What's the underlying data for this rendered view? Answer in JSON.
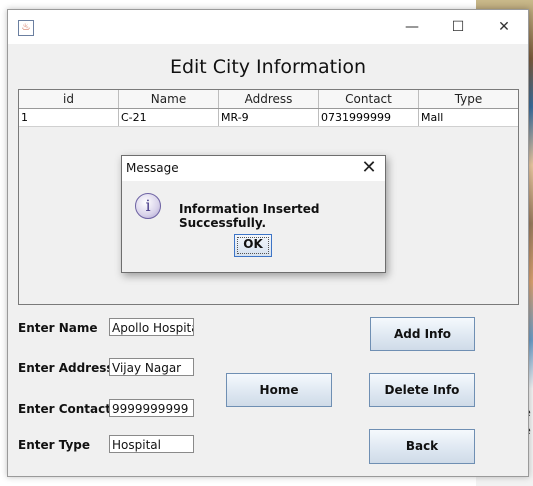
{
  "window": {
    "icon": "java-cup-icon",
    "controls": {
      "minimize": "—",
      "maximize": "☐",
      "close": "✕"
    }
  },
  "heading": "Edit City Information",
  "table": {
    "columns": [
      "id",
      "Name",
      "Address",
      "Contact",
      "Type"
    ],
    "rows": [
      [
        "1",
        "C-21",
        "MR-9",
        "0731999999",
        "Mall"
      ]
    ]
  },
  "form": {
    "name_label": "Enter Name",
    "name_value": "Apollo Hospital",
    "address_label": "Enter Address",
    "address_value": "Vijay Nagar",
    "contact_label": "Enter Contact",
    "contact_value": "9999999999",
    "type_label": "Enter Type",
    "type_value": "Hospital"
  },
  "buttons": {
    "add": "Add Info",
    "home": "Home",
    "delete": "Delete Info",
    "back": "Back"
  },
  "dialog": {
    "title": "Message",
    "close": "✕",
    "icon": "info-icon",
    "message": "Information Inserted Successfully.",
    "ok": "OK"
  },
  "desktop": {
    "text_fragment_1": "e",
    "text_fragment_2": "e"
  }
}
